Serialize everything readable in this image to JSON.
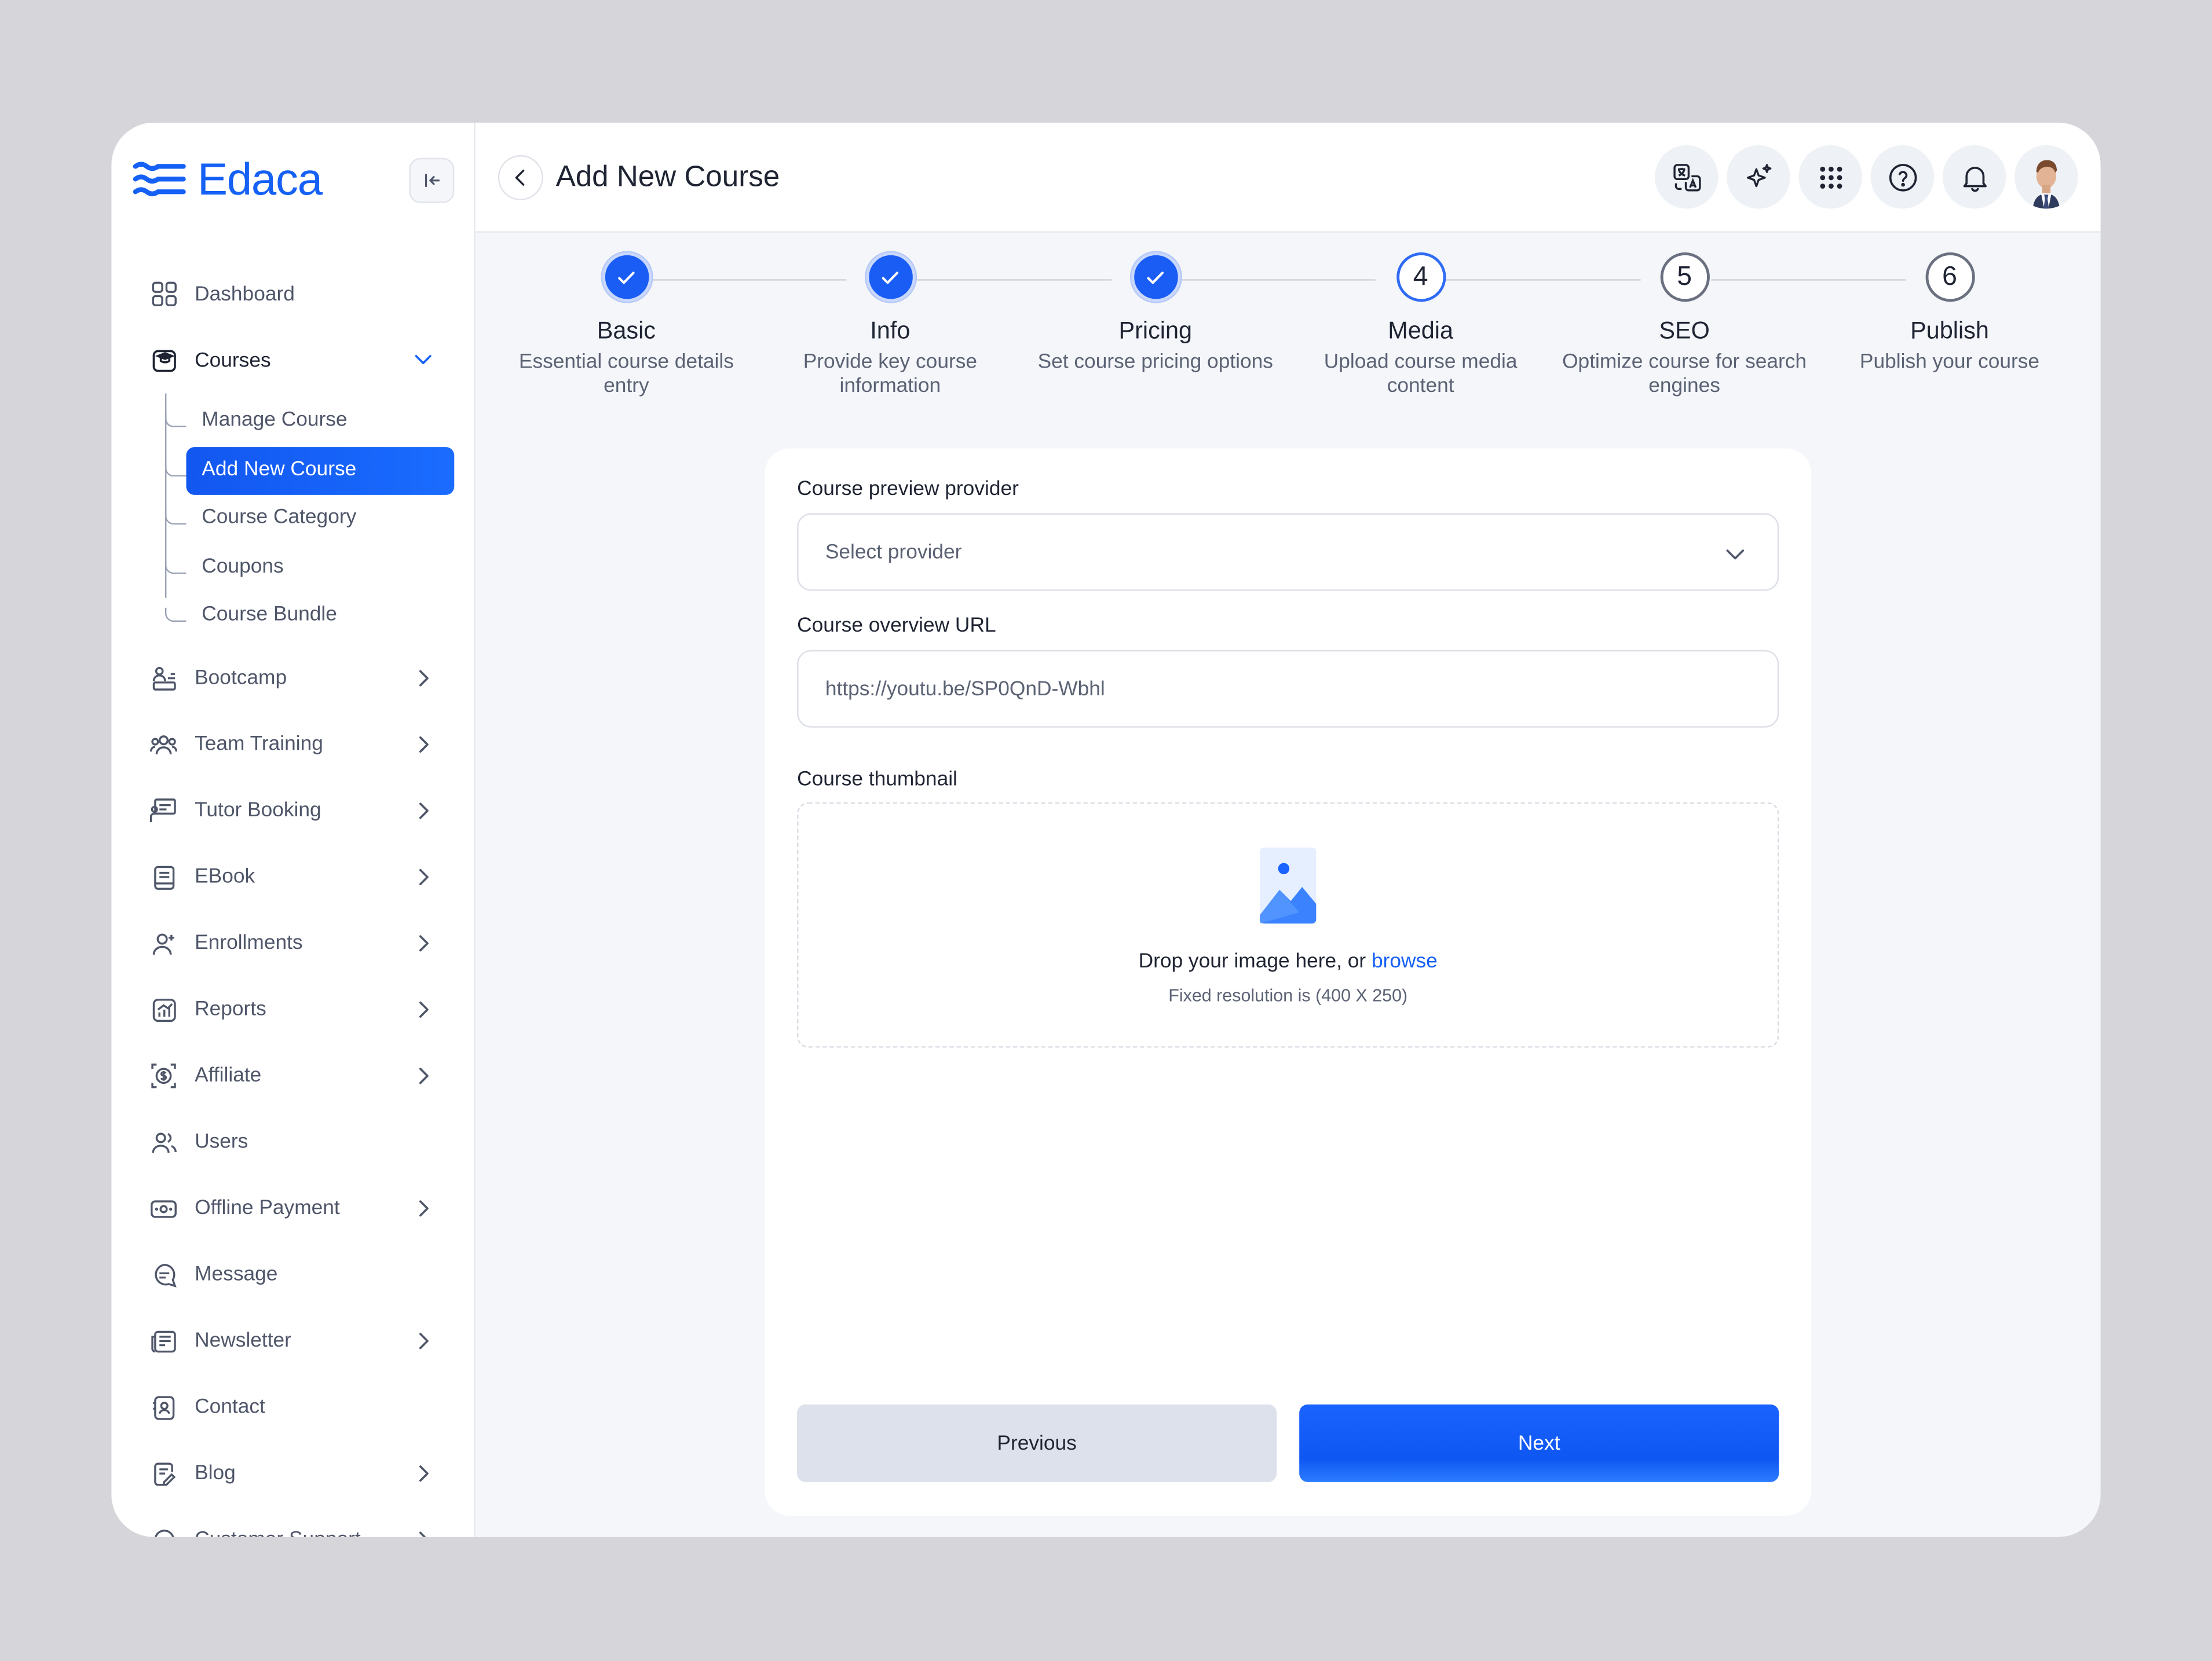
{
  "app": {
    "logo_text": "Edaca",
    "brand_color": "#1560f5"
  },
  "sidebar": {
    "items": [
      {
        "label": "Dashboard",
        "icon": "grid-icon",
        "chevron": false
      },
      {
        "label": "Courses",
        "icon": "graduation-cap-icon",
        "chevron": "down"
      },
      {
        "label": "Bootcamp",
        "icon": "bootcamp-icon",
        "chevron": true
      },
      {
        "label": "Team Training",
        "icon": "team-icon",
        "chevron": true
      },
      {
        "label": "Tutor Booking",
        "icon": "tutor-board-icon",
        "chevron": true
      },
      {
        "label": "EBook",
        "icon": "book-icon",
        "chevron": true
      },
      {
        "label": "Enrollments",
        "icon": "user-plus-icon",
        "chevron": true
      },
      {
        "label": "Reports",
        "icon": "report-chart-icon",
        "chevron": true
      },
      {
        "label": "Affiliate",
        "icon": "affiliate-dollar-icon",
        "chevron": true
      },
      {
        "label": "Users",
        "icon": "users-icon",
        "chevron": false
      },
      {
        "label": "Offline Payment",
        "icon": "cash-icon",
        "chevron": true
      },
      {
        "label": "Message",
        "icon": "message-icon",
        "chevron": false
      },
      {
        "label": "Newsletter",
        "icon": "newspaper-icon",
        "chevron": true
      },
      {
        "label": "Contact",
        "icon": "contact-icon",
        "chevron": false
      },
      {
        "label": "Blog",
        "icon": "blog-icon",
        "chevron": true
      },
      {
        "label": "Customer Support",
        "icon": "headset-icon",
        "chevron": true
      }
    ],
    "courses_sub": [
      {
        "label": "Manage Course",
        "active": false
      },
      {
        "label": "Add New Course",
        "active": true
      },
      {
        "label": "Course Category",
        "active": false
      },
      {
        "label": "Coupons",
        "active": false
      },
      {
        "label": "Course Bundle",
        "active": false
      }
    ]
  },
  "header": {
    "title": "Add New Course",
    "icons": [
      "language-icon",
      "sparkle-icon",
      "apps-grid-icon",
      "help-icon",
      "bell-icon"
    ]
  },
  "stepper": {
    "steps": [
      {
        "title": "Basic",
        "desc": "Essential course details entry",
        "state": "done",
        "number": "1"
      },
      {
        "title": "Info",
        "desc": "Provide key course information",
        "state": "done",
        "number": "2"
      },
      {
        "title": "Pricing",
        "desc": "Set course pricing options",
        "state": "done",
        "number": "3"
      },
      {
        "title": "Media",
        "desc": "Upload course media content",
        "state": "current",
        "number": "4"
      },
      {
        "title": "SEO",
        "desc": "Optimize course for search engines",
        "state": "todo",
        "number": "5"
      },
      {
        "title": "Publish",
        "desc": "Publish your course",
        "state": "todo",
        "number": "6"
      }
    ]
  },
  "form": {
    "provider_label": "Course preview provider",
    "provider_value": "Select provider",
    "url_label": "Course overview URL",
    "url_value": "https://youtu.be/SP0QnD-Wbhl",
    "thumb_label": "Course thumbnail",
    "drop_text": "Drop your image here, or ",
    "drop_link": "browse",
    "drop_hint": "Fixed resolution is (400 X 250)",
    "prev_label": "Previous",
    "next_label": "Next"
  }
}
